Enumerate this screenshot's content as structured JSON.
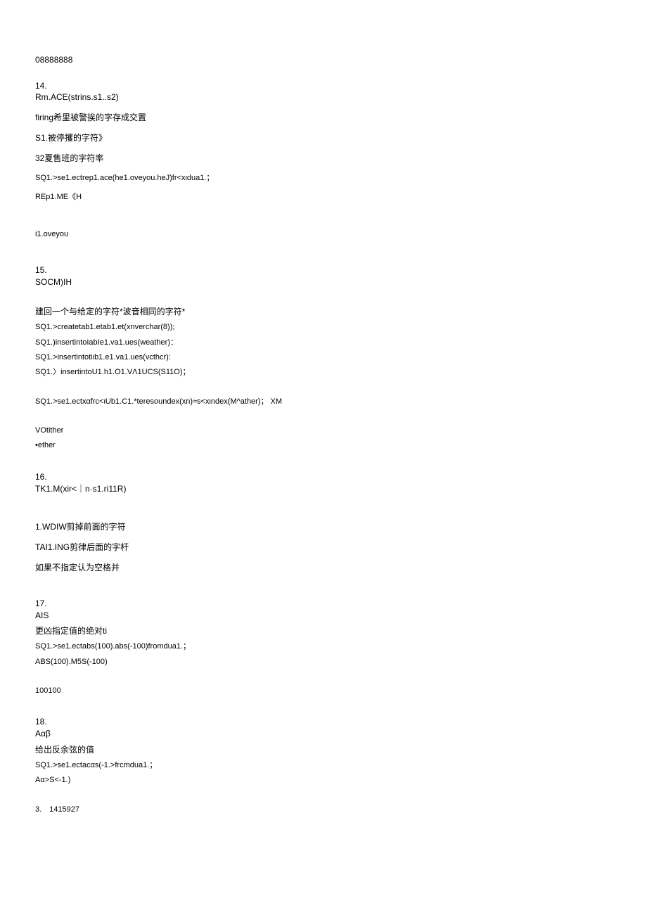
{
  "l0": "08888888",
  "i14": {
    "n": "14.",
    "title": "Rm.ACE(strins.s1..s2)",
    "a": "firing希里被警挨的字存成交置",
    "b": "S1.被停攫的字符》",
    "c": "32夏售班的字符率",
    "d": "SQ1.>se1.ectrep1.ace(he1.oveyou.heJ)fr<xιdua1.；",
    "e": "REp1.ME《H",
    "f": "i1.oveyou"
  },
  "i15": {
    "n": "15.",
    "title": "SOCM)IH",
    "a": "建回一个与给定的字符*波音相同的字符*",
    "b": "SQ1.>createtab1.etab1.et(xnverchar(8));",
    "c": "SQ1.)insertintoIabIe1.va1.ues(weather)：",
    "d": "SQ1.>insertintotiιb1.e1.va1.ues(vcthcr):",
    "e": "SQ1.〉insertintoU1.h1.O1.VΛ1UCS(S11O)；",
    "f": "SQ1.>se1.ectxαfrc<ιUb1.C1.*teresoundex(xn)≈s<xιndex(M^ather)； XM",
    "g": "VOtither",
    "h": "•ether"
  },
  "i16": {
    "n": "16.",
    "title": "TK1.M(xir<｜n·s1.ri11R)",
    "a": "1.WDIW剪掉前面的字符",
    "b": "TAI1.ING剪律后面的字杆",
    "c": "如果不指定认为空格并"
  },
  "i17": {
    "n": "17.",
    "title": "AIS",
    "a": "更凶指定值的绝对ti",
    "b": "SQ1.>se1.ectabs(100).abs(-100)fromdua1.；",
    "c": "ABS(100).M5S(-100)",
    "d": "100100"
  },
  "i18": {
    "n": "18.",
    "title": "Aαβ",
    "a": "给出反余弦的值",
    "b": "SQ1.>se1.ectacαs(-1.>frcmdua1.；",
    "c": "Aα>S<-1.)",
    "d": "3.　1415927"
  }
}
